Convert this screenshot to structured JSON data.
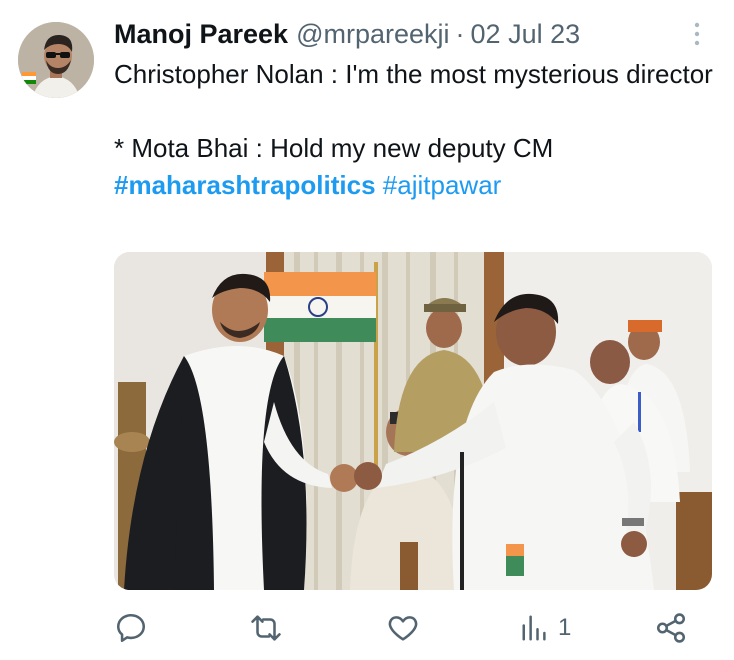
{
  "tweet": {
    "author_name": "Manoj Pareek",
    "author_handle": "@mrpareekji",
    "separator": "·",
    "date": "02 Jul 23",
    "text_line_1": "Christopher Nolan : I'm the most mysterious director",
    "text_line_2": "* Mota Bhai : Hold my new deputy CM",
    "hashtag_1": "#maharashtrapolitics",
    "hashtag_2": "#ajitpawar"
  },
  "actions": {
    "reply_icon": "speech-bubble",
    "retweet_icon": "retweet-arrows",
    "like_icon": "heart",
    "views_icon": "bar-chart",
    "views_count": "1",
    "share_icon": "share-nodes"
  },
  "colors": {
    "text": "#0f1419",
    "secondary": "#536471",
    "link": "#1d9bf0"
  }
}
